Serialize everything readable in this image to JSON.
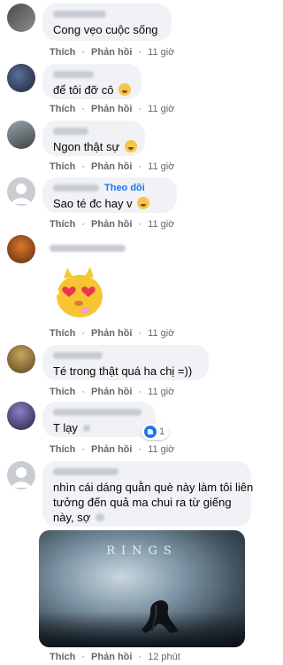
{
  "actions": {
    "like": "Thích",
    "reply": "Phản hồi",
    "follow": "Theo dõi"
  },
  "comments": [
    {
      "text": "Cong vẹo cuộc sống",
      "time": "11 giờ"
    },
    {
      "text": "để tôi đỡ cô",
      "emoji": "grinning-face",
      "time": "11 giờ"
    },
    {
      "text": "Ngon thật sự",
      "emoji": "tongue-face",
      "time": "11 giờ"
    },
    {
      "text": "Sao té đc hay v",
      "emoji": "upside-down-face",
      "time": "11 giờ",
      "follow": true
    },
    {
      "sticker": "heart-eyes-chick-sticker",
      "time": "11 giờ"
    },
    {
      "text": "Té trong thật quá ha chị =))",
      "time": "11 giờ"
    },
    {
      "text": "T lạy",
      "time": "11 giờ",
      "reaction_count": "1"
    },
    {
      "text": "nhìn cái dáng quằn què này làm tôi liên tưởng đến quả ma chui ra từ giếng này, sợ",
      "time": "12 phút",
      "poster_title": "RINGS"
    }
  ],
  "colors": {
    "bubble": "#f0f2f5",
    "link": "#1877f2",
    "meta": "#65676b",
    "text": "#050505"
  }
}
